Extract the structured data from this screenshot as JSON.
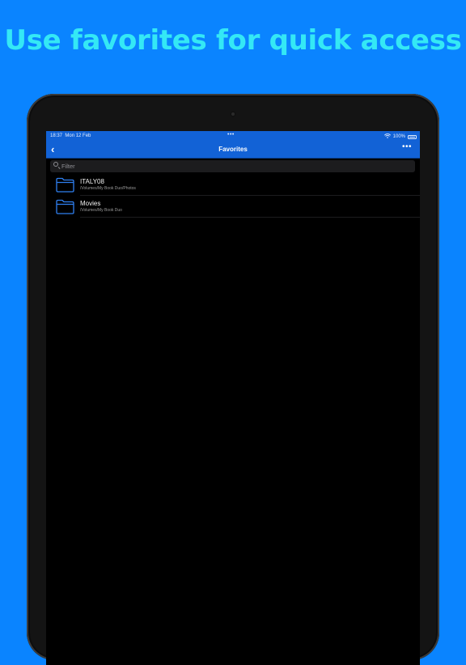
{
  "headline": "Use favorites for quick access",
  "status_bar": {
    "time": "18:37",
    "date": "Mon 12 Feb",
    "center_dots": "•••",
    "battery": "100%",
    "wifi_icon": "wifi-icon"
  },
  "nav": {
    "title": "Favorites",
    "back_icon": "chevron-left-icon",
    "more_label": "•••",
    "back_label": "‹"
  },
  "filter": {
    "placeholder": "Filter",
    "value": ""
  },
  "favorites": [
    {
      "name": "ITALY08",
      "path": "/Volumes/My Book Duo/Photos"
    },
    {
      "name": "Movies",
      "path": "/Volumes/My Book Duo"
    }
  ],
  "colors": {
    "background": "#0a84ff",
    "headline": "#34e8f5",
    "bar": "#1262d6",
    "folder_stroke": "#2f7ff0"
  }
}
